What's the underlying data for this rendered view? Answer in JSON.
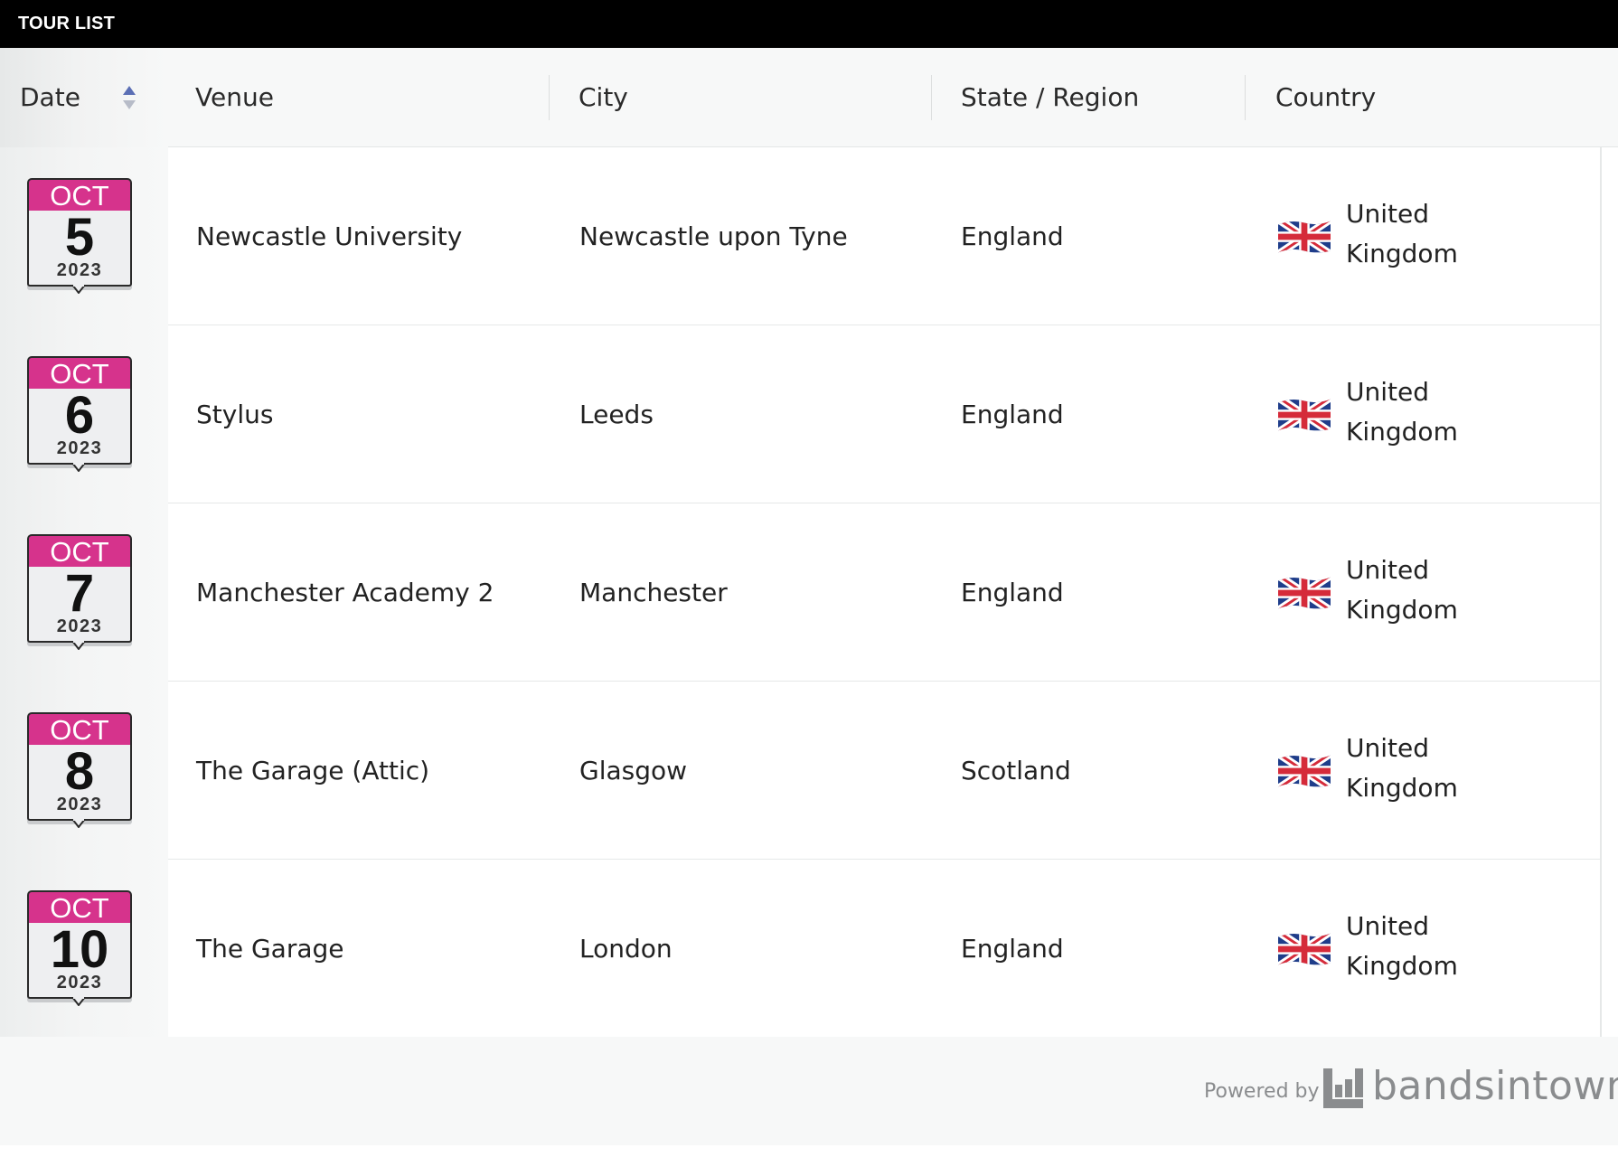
{
  "widget": {
    "title": "TOUR LIST"
  },
  "columns": {
    "date": "Date",
    "venue": "Venue",
    "city": "City",
    "region": "State / Region",
    "country": "Country"
  },
  "events": [
    {
      "month": "OCT",
      "day": "5",
      "year": "2023",
      "venue": "Newcastle University",
      "city": "Newcastle upon Tyne",
      "region": "England",
      "country_line1": "United",
      "country_line2": "Kingdom"
    },
    {
      "month": "OCT",
      "day": "6",
      "year": "2023",
      "venue": "Stylus",
      "city": "Leeds",
      "region": "England",
      "country_line1": "United",
      "country_line2": "Kingdom"
    },
    {
      "month": "OCT",
      "day": "7",
      "year": "2023",
      "venue": "Manchester Academy 2",
      "city": "Manchester",
      "region": "England",
      "country_line1": "United",
      "country_line2": "Kingdom"
    },
    {
      "month": "OCT",
      "day": "8",
      "year": "2023",
      "venue": "The Garage (Attic)",
      "city": "Glasgow",
      "region": "Scotland",
      "country_line1": "United",
      "country_line2": "Kingdom"
    },
    {
      "month": "OCT",
      "day": "10",
      "year": "2023",
      "venue": "The Garage",
      "city": "London",
      "region": "England",
      "country_line1": "United",
      "country_line2": "Kingdom"
    }
  ],
  "footer": {
    "powered_by": "Powered by",
    "brand": "bandsintown"
  },
  "icons": {
    "sort": "sort-up-down-icon",
    "flag": "uk-flag-icon",
    "calendar": "calendar-date-icon",
    "brand_logo": "bandsintown-logo-icon"
  },
  "colors": {
    "title_bar": "#000000",
    "calendar_accent": "#d6338c",
    "header_bg": "#f7f8f8",
    "footer_text": "#8a8c8e"
  }
}
